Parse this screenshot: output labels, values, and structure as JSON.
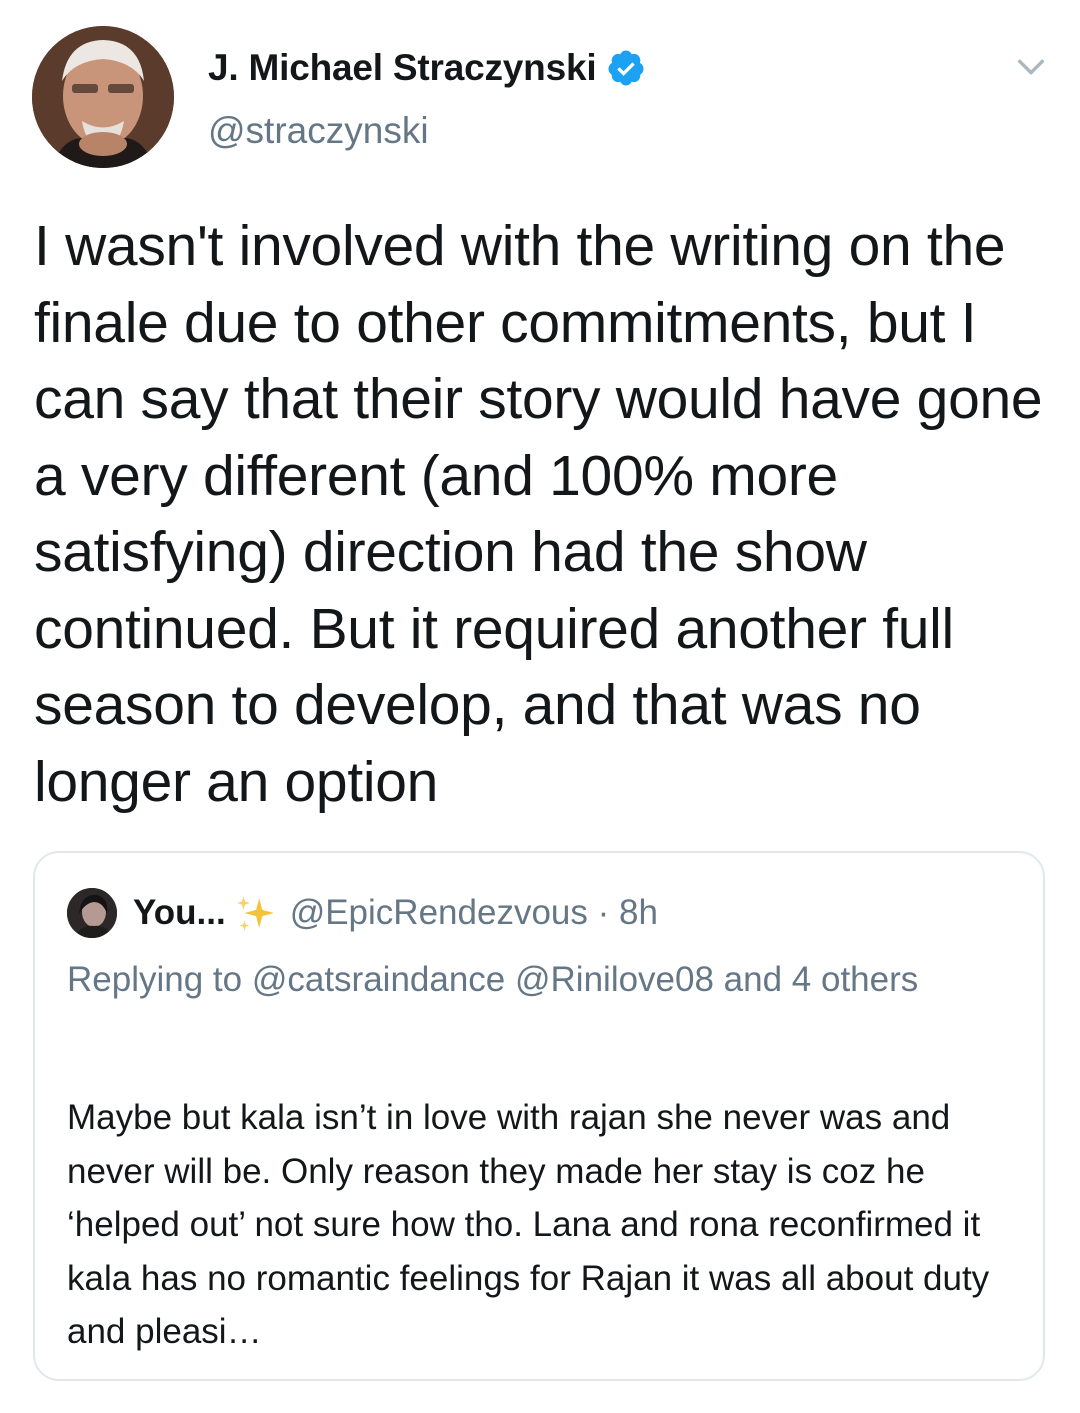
{
  "tweet": {
    "author": {
      "name": "J. Michael Straczynski",
      "handle": "@straczynski",
      "verified": true
    },
    "text": "I wasn't involved with the writing on the finale due to other commitments, but I can say that their story would have gone a very different (and 100% more satisfying) direction had the show continued. But it required another full season to develop, and that was no longer an option"
  },
  "quoted_tweet": {
    "author_name": "You...",
    "handle_time": "@EpicRendezvous · 8h",
    "replying_to": "Replying to @catsraindance @Rinilove08 and 4 others",
    "text": "Maybe but kala isn’t in love with rajan she never was and never will be. Only reason they made her stay is coz he ‘helped out’ not sure how tho. Lana and rona reconfirmed it kala has no romantic feelings for Rajan it was all about duty and pleasi…"
  },
  "colors": {
    "text_primary": "#14171a",
    "text_secondary": "#657786",
    "verified_blue": "#1da1f2",
    "border": "#e1e8ed",
    "sparkle_gold": "#f5c33b"
  },
  "icons": {
    "verified": "verified-badge-icon",
    "caret": "chevron-down-icon",
    "sparkles": "sparkles-emoji-icon"
  }
}
